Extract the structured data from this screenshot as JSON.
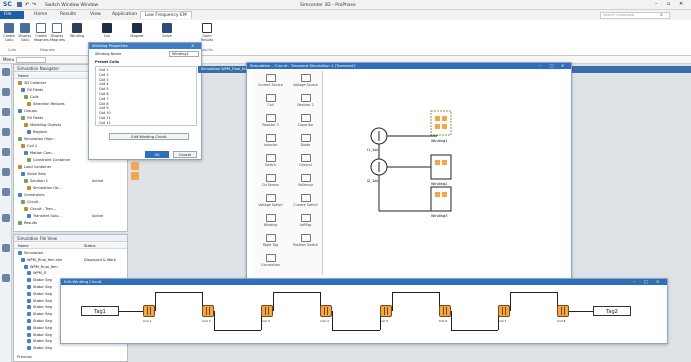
{
  "titlebar": {
    "app_icon": "sc-logo-icon",
    "title": "Simcenter 3D - ProPhase",
    "qat": [
      "save-icon",
      "undo-icon",
      "redo-icon",
      "switch-window-icon"
    ],
    "qat_text": "Switch Window  Window",
    "window_controls": [
      "minimize-icon",
      "restore-icon",
      "close-icon"
    ],
    "search_placeholder": "Search Command"
  },
  "tabs": [
    {
      "label": "File"
    },
    {
      "label": "Home"
    },
    {
      "label": "Results"
    },
    {
      "label": "View"
    },
    {
      "label": "Application"
    },
    {
      "label": "Low Frequency EM"
    }
  ],
  "ribbon": {
    "buttons": [
      {
        "label": "Create Coils"
      },
      {
        "label": "Display Coils"
      },
      {
        "label": "Create Magnets"
      },
      {
        "label": "Display Magnets"
      },
      {
        "label": "Winding"
      },
      {
        "label": "Coil"
      },
      {
        "label": "Magnet"
      },
      {
        "label": "Solve"
      },
      {
        "label": "Open Results"
      }
    ],
    "groups": [
      {
        "label": "Coils"
      },
      {
        "label": "Magnets"
      },
      {
        "label": "Results"
      }
    ],
    "menu_label": "Menu"
  },
  "winding_props": {
    "title": "Winding Properties",
    "field_label": "Winding Name",
    "field_value": "Winding1",
    "section_label": "Preset Coils",
    "coils": [
      "Coil 1",
      "Coil 2",
      "Coil 3",
      "Coil 4",
      "Coil 5",
      "Coil 6",
      "Coil 7",
      "Coil 8",
      "Coil 9",
      "Coil 10",
      "Coil 11",
      "Coil 12"
    ],
    "edit_button": "Edit Winding Circuit",
    "ok": "OK",
    "cancel": "Cancel"
  },
  "nav": {
    "title": "Simulation Navigator",
    "header_name": "Name",
    "header_status": "Status",
    "rows": [
      {
        "label": "3D Collector",
        "status": ""
      },
      {
        "label": "Fill Fields",
        "status": ""
      },
      {
        "label": "Coils",
        "status": ""
      },
      {
        "label": "Selection Recipes",
        "status": ""
      },
      {
        "label": "Groups",
        "status": ""
      },
      {
        "label": "Fill Fields",
        "status": ""
      },
      {
        "label": "Modeling Objects",
        "status": ""
      },
      {
        "label": "Regions",
        "status": ""
      },
      {
        "label": "Simulation Obje...",
        "status": ""
      },
      {
        "label": "Coil 1",
        "status": ""
      },
      {
        "label": "Motion Com...",
        "status": ""
      },
      {
        "label": "Constraint Container",
        "status": ""
      },
      {
        "label": "Load Container",
        "status": ""
      },
      {
        "label": "Solve Sets",
        "status": ""
      },
      {
        "label": "Solution 1",
        "status": "Active"
      },
      {
        "label": "Simulation Ob...",
        "status": ""
      },
      {
        "label": "Constraints",
        "status": ""
      },
      {
        "label": "Circuit",
        "status": ""
      },
      {
        "label": "Circuit - Tran...",
        "status": ""
      },
      {
        "label": "Transient Solu...",
        "status": "Active"
      },
      {
        "label": "Results",
        "status": ""
      }
    ]
  },
  "file_view": {
    "title": "Simulation File View",
    "header_name": "Name",
    "header_status": "Status",
    "rows": [
      {
        "label": "Simulation",
        "status": ""
      },
      {
        "label": "WPM_Final_fem.sim",
        "status": "Displayed & Work"
      },
      {
        "label": "WPM_Final_fem",
        "status": ""
      },
      {
        "label": "WPM_Fi",
        "status": ""
      },
      {
        "label": "Stator Seg",
        "status": ""
      },
      {
        "label": "Stator Seg",
        "status": ""
      },
      {
        "label": "Stator Seg",
        "status": ""
      },
      {
        "label": "Stator Seg",
        "status": ""
      },
      {
        "label": "Stator Seg",
        "status": ""
      },
      {
        "label": "Stator Seg",
        "status": ""
      },
      {
        "label": "Stator Seg",
        "status": ""
      },
      {
        "label": "Stator Seg",
        "status": ""
      },
      {
        "label": "Stator Seg",
        "status": ""
      },
      {
        "label": "Stator Seg",
        "status": ""
      },
      {
        "label": "Stator Seg",
        "status": ""
      }
    ],
    "preview_label": "Preview"
  },
  "background_tab": "Simulation WPM_Final_fem.sim",
  "sim_circuit": {
    "title": "Simulation - 'Circuit - Transient Simulation 1 (Transient)'",
    "palette": [
      {
        "label": "Current Source",
        "icon": "current-source-icon"
      },
      {
        "label": "Voltage Source",
        "icon": "voltage-source-icon"
      },
      {
        "label": "Coil",
        "icon": "coil-icon"
      },
      {
        "label": "Resistor 2",
        "icon": "resistor-icon"
      },
      {
        "label": "Resistor 3",
        "icon": "resistor-icon"
      },
      {
        "label": "Capacitor",
        "icon": "capacitor-icon"
      },
      {
        "label": "Inductor",
        "icon": "inductor-icon"
      },
      {
        "label": "Diode",
        "icon": "diode-icon"
      },
      {
        "label": "Switch",
        "icon": "switch-icon"
      },
      {
        "label": "Ground",
        "icon": "ground-icon"
      },
      {
        "label": "CurSensor",
        "icon": "current-sensor-icon"
      },
      {
        "label": "VoSensor",
        "icon": "voltage-sensor-icon"
      },
      {
        "label": "Voltage Switch",
        "icon": "voltage-switch-icon"
      },
      {
        "label": "Current Switch",
        "icon": "current-switch-icon"
      },
      {
        "label": "Winding",
        "icon": "winding-icon"
      },
      {
        "label": "LeftTag",
        "icon": "left-tag-icon"
      },
      {
        "label": "Right Tag",
        "icon": "right-tag-icon"
      },
      {
        "label": "Position Switch",
        "icon": "position-switch-icon"
      },
      {
        "label": "Connection",
        "icon": "connection-icon"
      }
    ],
    "sources": [
      {
        "label": "I1_1dc"
      },
      {
        "label": "I2_1dc"
      }
    ],
    "windings": [
      {
        "label": "Winding1"
      },
      {
        "label": "Winding2"
      },
      {
        "label": "Winding3"
      }
    ]
  },
  "edit_circuit": {
    "title": "Edit Winding Circuit",
    "left_tag": "Tag1",
    "right_tag": "Tag2",
    "coils": [
      "Coil 1",
      "Coil 2",
      "Coil 3",
      "Coil 4",
      "Coil 5",
      "Coil 6",
      "Coil 7",
      "Coil 8"
    ]
  },
  "colors": {
    "accent": "#1f5fa8",
    "dialog_title": "#3f7cc4",
    "coil": "#f3a74c",
    "workspace": "#dfe3e8"
  }
}
